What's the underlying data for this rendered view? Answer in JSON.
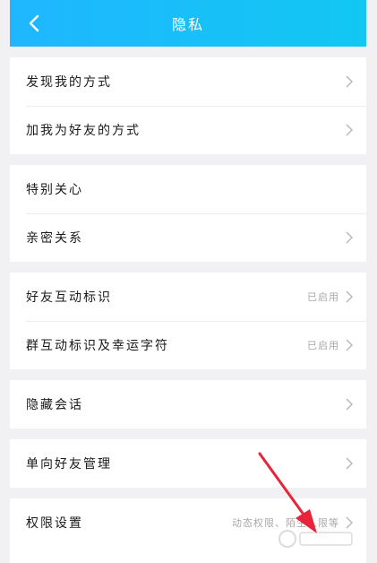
{
  "header": {
    "title": "隐私",
    "back_icon": "chevron-left-icon"
  },
  "groups": [
    {
      "items": [
        {
          "label": "发现我的方式",
          "status": ""
        },
        {
          "label": "加我为好友的方式",
          "status": ""
        }
      ]
    },
    {
      "items": [
        {
          "label": "特别关心",
          "status": ""
        },
        {
          "label": "亲密关系",
          "status": ""
        }
      ]
    },
    {
      "items": [
        {
          "label": "好友互动标识",
          "status": "已启用"
        },
        {
          "label": "群互动标识及幸运字符",
          "status": "已启用"
        }
      ]
    },
    {
      "items": [
        {
          "label": "隐藏会话",
          "status": ""
        }
      ]
    },
    {
      "items": [
        {
          "label": "单向好友管理",
          "status": ""
        }
      ]
    },
    {
      "items": [
        {
          "label": "权限设置",
          "status": "动态权限、陌生人限等"
        }
      ]
    }
  ],
  "colors": {
    "header_start": "#1fb7ff",
    "header_end": "#12c7f2",
    "annotation_arrow": "#e8243a"
  }
}
